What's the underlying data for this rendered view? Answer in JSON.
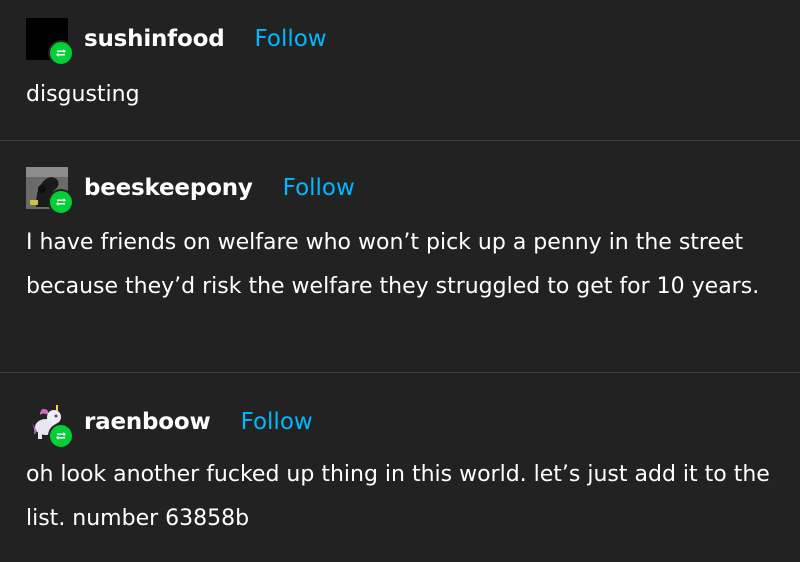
{
  "colors": {
    "background": "#222222",
    "divider": "#3a3a3a",
    "follow": "#00b8ff",
    "reblog_badge": "#00cf35",
    "text": "#ffffff"
  },
  "posts": [
    {
      "username": "sushinfood",
      "follow_label": "Follow",
      "avatar_icon": "black-square-avatar",
      "badge_icon": "reblog-icon",
      "text": "disgusting"
    },
    {
      "username": "beeskeepony",
      "follow_label": "Follow",
      "avatar_icon": "dark-pony-avatar",
      "badge_icon": "reblog-icon",
      "text": "I have friends on welfare who won’t pick up a penny in the street because they’d risk the welfare they struggled to get for 10 years."
    },
    {
      "username": "raenboow",
      "follow_label": "Follow",
      "avatar_icon": "pony-sprite-avatar",
      "badge_icon": "reblog-icon",
      "text": "oh look another fucked up thing in this world. let’s just add it to the list. number 63858b"
    }
  ]
}
